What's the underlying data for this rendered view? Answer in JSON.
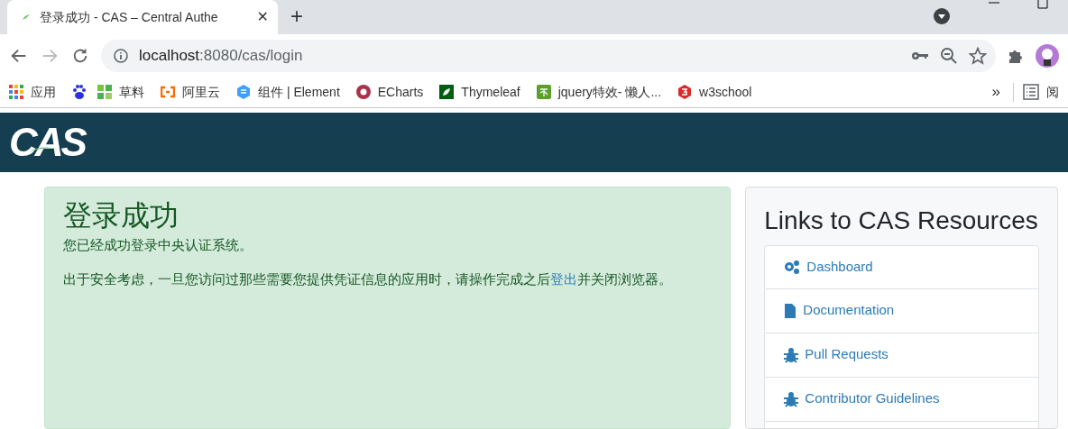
{
  "browser": {
    "tab_title": "登录成功 - CAS – Central Authe",
    "close_tab": "✕",
    "new_tab": "+",
    "address": {
      "host": "localhost",
      "path": ":8080/cas/login"
    },
    "bookmarks": [
      {
        "kind": "labeled",
        "label": "应用"
      },
      {
        "kind": "icon"
      },
      {
        "kind": "labeled",
        "label": "草料"
      },
      {
        "kind": "labeled",
        "label": "阿里云"
      },
      {
        "kind": "labeled",
        "label": "组件 | Element"
      },
      {
        "kind": "labeled",
        "label": "ECharts"
      },
      {
        "kind": "labeled",
        "label": "Thymeleaf"
      },
      {
        "kind": "labeled",
        "label": "jquery特效- 懒人..."
      },
      {
        "kind": "labeled",
        "label": "w3school"
      }
    ],
    "overflow": "»",
    "reading_list": "阅"
  },
  "header": {
    "logo": "CAS"
  },
  "success": {
    "title": "登录成功",
    "message": "您已经成功登录中央认证系统。",
    "note": {
      "before": "出于安全考虑，一旦您访问过那些需要您提供凭证信息的应用时，请操作完成之后",
      "link": "登出",
      "after": "并关闭浏览器。"
    }
  },
  "resources": {
    "title": "Links to CAS Resources",
    "links": [
      {
        "label": "Dashboard"
      },
      {
        "label": "Documentation"
      },
      {
        "label": "Pull Requests"
      },
      {
        "label": "Contributor Guidelines"
      }
    ]
  }
}
